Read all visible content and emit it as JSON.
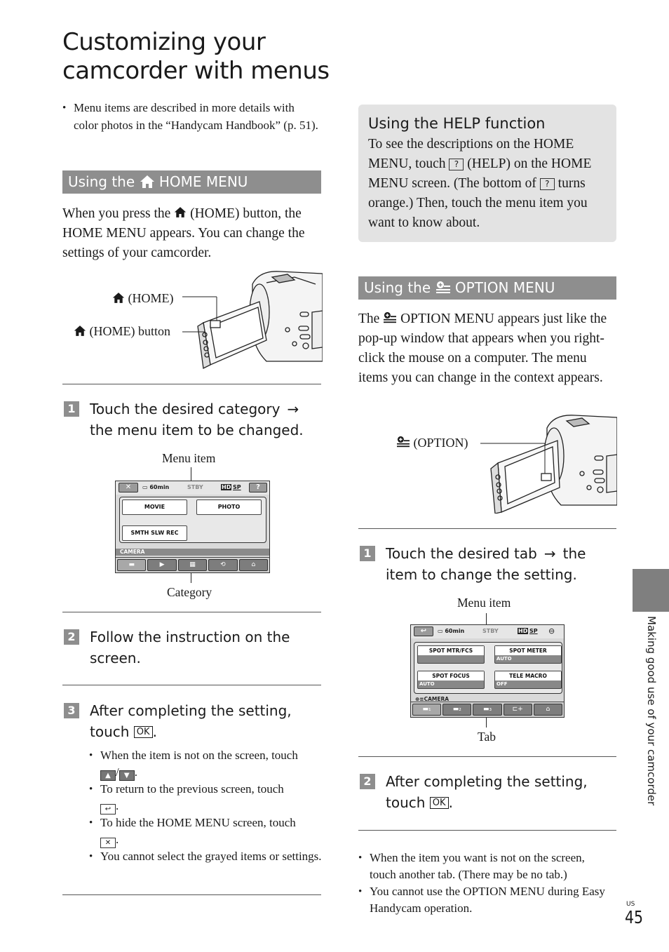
{
  "page": {
    "title": "Customizing your camcorder with menus",
    "side_tab_label": "Making good use of your camcorder",
    "region_code": "US",
    "page_number": "45"
  },
  "intro": {
    "note": "Menu items are described in more details with color photos in the “Handycam Handbook” (p. 51)."
  },
  "home_section": {
    "heading_prefix": "Using the",
    "heading_icon": "home-icon",
    "heading_suffix": "HOME MENU",
    "body_a": "When you press the",
    "body_b": "(HOME) button, the HOME MENU appears. You can change the settings of your camcorder.",
    "callout_home": "(HOME)",
    "callout_home_button": "(HOME) button",
    "steps": [
      {
        "num": "1",
        "text_a": "Touch the desired category",
        "arrow": "→",
        "text_b": "the menu item to be changed."
      },
      {
        "num": "2",
        "text": "Follow the instruction on the screen."
      },
      {
        "num": "3",
        "text": "After completing the setting, touch",
        "button": "OK"
      }
    ],
    "diagram": {
      "label_top": "Menu item",
      "label_bottom": "Category",
      "status": {
        "close": "✕",
        "battery": "60min",
        "mode": "STBY",
        "hd": "HD",
        "quality": "SP",
        "help": "?"
      },
      "items": [
        "MOVIE",
        "PHOTO",
        "SMTH SLW REC"
      ],
      "category": "CAMERA",
      "tabs": [
        "camera-icon",
        "playback-icon",
        "other-icon",
        "manage-media-icon",
        "settings-icon"
      ]
    },
    "notes": [
      {
        "text": "When the item is not on the screen, touch",
        "buttons": [
          "▲",
          "▼"
        ],
        "sep": "/"
      },
      {
        "text": "To return to the previous screen, touch",
        "buttons": [
          "↩"
        ]
      },
      {
        "text": "To hide the HOME MENU screen, touch",
        "buttons": [
          "✕"
        ]
      },
      {
        "text": "You cannot select the grayed items or settings."
      }
    ]
  },
  "help_section": {
    "title": "Using the HELP function",
    "body_1": "To see the descriptions on the HOME MENU, touch",
    "help_icon": "?",
    "body_2": "(HELP) on the HOME MENU screen. (The bottom of",
    "body_3": "turns orange.) Then, touch the menu item you want to know about."
  },
  "option_section": {
    "heading_prefix": "Using the",
    "heading_icon": "option-icon",
    "heading_suffix": "OPTION MENU",
    "body_a": "The",
    "body_b": "OPTION MENU appears just like the pop-up window that appears when you right-click the mouse on a computer. The menu items you can change in the context appears.",
    "callout_option": "(OPTION)",
    "steps": [
      {
        "num": "1",
        "text_a": "Touch the desired tab",
        "arrow": "→",
        "text_b": "the item to change the setting."
      },
      {
        "num": "2",
        "text": "After completing the setting, touch",
        "button": "OK"
      }
    ],
    "diagram": {
      "label_top": "Menu item",
      "label_bottom": "Tab",
      "status": {
        "back": "↩",
        "battery": "60min",
        "mode": "STBY",
        "hd": "HD",
        "quality": "SP"
      },
      "items": [
        {
          "title": "SPOT MTR/FCS",
          "value": ""
        },
        {
          "title": "SPOT METER",
          "value": "AUTO"
        },
        {
          "title": "SPOT FOCUS",
          "value": "AUTO"
        },
        {
          "title": "TELE MACRO",
          "value": "OFF"
        }
      ],
      "category": "CAMERA",
      "tabs": [
        "camera-1",
        "camera-2",
        "camera-3",
        "add",
        "settings"
      ]
    },
    "notes": [
      "When the item you want is not on the screen, touch another tab. (There may be no tab.)",
      "You cannot use the OPTION MENU during Easy Handycam operation."
    ]
  }
}
